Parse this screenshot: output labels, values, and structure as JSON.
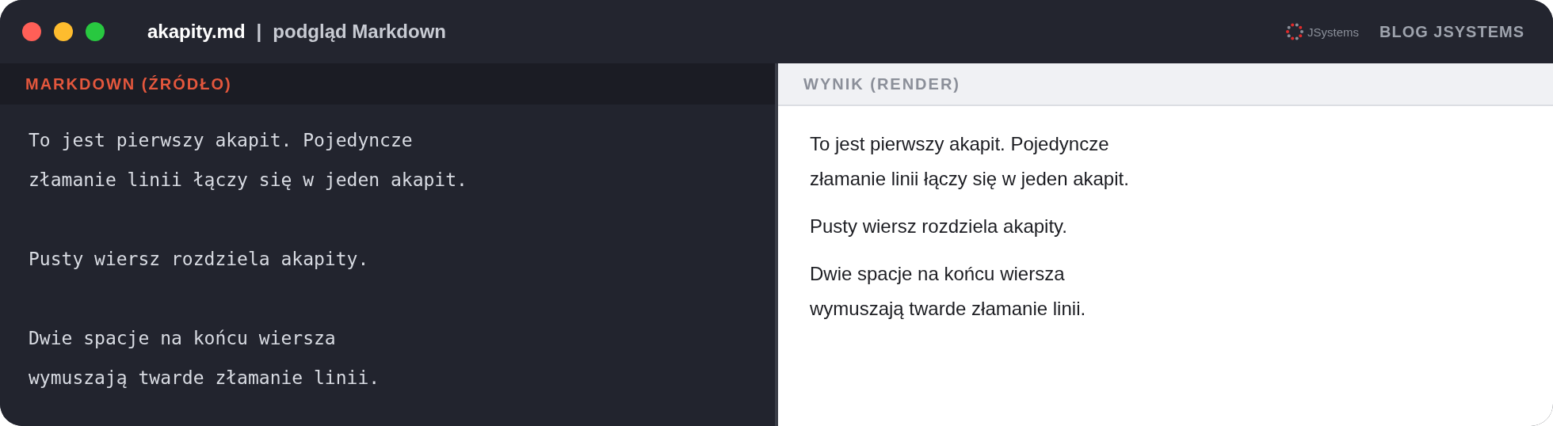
{
  "window": {
    "file_name": "akapity.md",
    "separator": "|",
    "subtitle": "podgląd Markdown",
    "logo_text": "JSystems",
    "brand": "BLOG JSYSTEMS"
  },
  "source_pane": {
    "header": "MARKDOWN (ŹRÓDŁO)",
    "paragraphs": [
      [
        "To jest pierwszy akapit. Pojedyncze",
        "złamanie linii łączy się w jeden akapit."
      ],
      [
        "Pusty wiersz rozdziela akapity."
      ],
      [
        "Dwie spacje na końcu wiersza",
        "wymuszają twarde złamanie linii."
      ]
    ]
  },
  "render_pane": {
    "header": "WYNIK (RENDER)",
    "paragraphs": [
      [
        "To jest pierwszy akapit. Pojedyncze",
        "złamanie linii łączy się w jeden akapit."
      ],
      [
        "Pusty wiersz rozdziela akapity."
      ],
      [
        "Dwie spacje na końcu wiersza",
        "wymuszają twarde złamanie linii."
      ]
    ]
  }
}
